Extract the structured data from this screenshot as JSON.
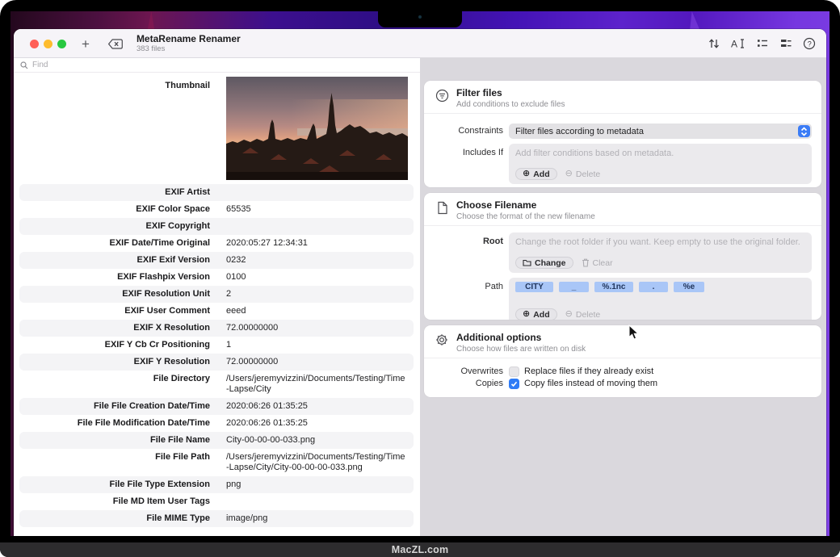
{
  "frame": {
    "brand": "MacZL.com"
  },
  "window": {
    "title": "MetaRename Renamer",
    "files_count": "383 files",
    "search": {
      "placeholder": "Find"
    },
    "toolbar_icons": [
      "plus-icon",
      "clear-backspace-icon",
      "sort-arrows-icon",
      "text-format-icon",
      "bullet-list-icon",
      "detail-list-icon",
      "help-icon"
    ]
  },
  "metadata_table": {
    "thumbnail": {
      "label": "Thumbnail",
      "description": "city-skyline-sunset-photo"
    },
    "rows": [
      {
        "label": "EXIF Artist",
        "value": ""
      },
      {
        "label": "EXIF Color Space",
        "value": "65535"
      },
      {
        "label": "EXIF Copyright",
        "value": ""
      },
      {
        "label": "EXIF Date/Time Original",
        "value": "2020:05:27 12:34:31"
      },
      {
        "label": "EXIF Exif Version",
        "value": "0232"
      },
      {
        "label": "EXIF Flashpix Version",
        "value": "0100"
      },
      {
        "label": "EXIF Resolution Unit",
        "value": "2"
      },
      {
        "label": "EXIF User Comment",
        "value": "eeed"
      },
      {
        "label": "EXIF X Resolution",
        "value": "72.00000000"
      },
      {
        "label": "EXIF Y Cb Cr Positioning",
        "value": "1"
      },
      {
        "label": "EXIF Y Resolution",
        "value": "72.00000000"
      },
      {
        "label": "File Directory",
        "value": "/Users/jeremyvizzini/Documents/Testing/Time-Lapse/City"
      },
      {
        "label": "File File Creation Date/Time",
        "value": "2020:06:26 01:35:25"
      },
      {
        "label": "File File Modification Date/Time",
        "value": "2020:06:26 01:35:25"
      },
      {
        "label": "File File Name",
        "value": "City-00-00-00-033.png"
      },
      {
        "label": "File File Path",
        "value": "/Users/jeremyvizzini/Documents/Testing/Time-Lapse/City/City-00-00-00-033.png"
      },
      {
        "label": "File File Type Extension",
        "value": "png"
      },
      {
        "label": "File MD Item User Tags",
        "value": ""
      },
      {
        "label": "File MIME Type",
        "value": "image/png"
      }
    ]
  },
  "panels": {
    "filter": {
      "title": "Filter files",
      "subtitle": "Add conditions to exclude files",
      "constraints_label": "Constraints",
      "constraints_value": "Filter files according to metadata",
      "includes_label": "Includes If",
      "includes_placeholder": "Add filter conditions based on metadata.",
      "add_label": "Add",
      "delete_label": "Delete"
    },
    "filename": {
      "title": "Choose Filename",
      "subtitle": "Choose the format of the new filename",
      "root_label": "Root",
      "root_placeholder": "Change the root folder if you want. Keep empty to use the original folder.",
      "change_label": "Change",
      "clear_label": "Clear",
      "path_label": "Path",
      "path_tokens": [
        "CITY",
        "_",
        "%.1nc",
        ".",
        "%e"
      ],
      "add_label": "Add",
      "delete_label": "Delete"
    },
    "options": {
      "title": "Additional options",
      "subtitle": "Choose how files are written on disk",
      "rows": [
        {
          "label": "Overwrites",
          "text": "Replace files if they already exist",
          "checked": false
        },
        {
          "label": "Copies",
          "text": "Copy files instead of moving them",
          "checked": true
        }
      ]
    }
  },
  "colors": {
    "accent_blue": "#3b7cf6",
    "token_blue": "#a9c6f7",
    "right_panel_bg": "#dad8dd",
    "row_shade": "#f4f4f6"
  }
}
